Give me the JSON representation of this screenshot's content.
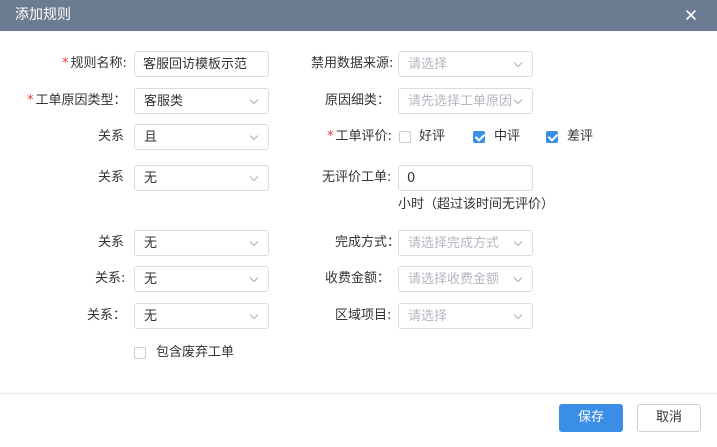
{
  "dialog": {
    "title": "添加规则",
    "close_icon": "close-icon"
  },
  "form": {
    "rule_name": {
      "label": "规则名称:",
      "value": "客服回访模板示范"
    },
    "disable_source": {
      "label": "禁用数据来源:",
      "placeholder": "请选择"
    },
    "order_reason_type": {
      "label": "工单原因类型：",
      "value": "客服类"
    },
    "reason_detail": {
      "label": "原因细类：",
      "placeholder": "请先选择工单原因"
    },
    "relation1": {
      "label": "关系",
      "value": "且"
    },
    "order_rating": {
      "label": "工单评价:",
      "options": [
        {
          "label": "好评",
          "checked": false
        },
        {
          "label": "中评",
          "checked": true
        },
        {
          "label": "差评",
          "checked": true
        }
      ]
    },
    "relation2": {
      "label": "关系",
      "value": "无"
    },
    "no_rating_order": {
      "label": "无评价工单:",
      "value": "0",
      "hint": "小时（超过该时间无评价）"
    },
    "relation3": {
      "label": "关系",
      "value": "无"
    },
    "complete_method": {
      "label": "完成方式：",
      "placeholder": "请选择完成方式"
    },
    "relation4": {
      "label": "关系:",
      "value": "无"
    },
    "fee_amount": {
      "label": "收费金额：",
      "placeholder": "请选择收费金额"
    },
    "relation5": {
      "label": "关系：",
      "value": "无"
    },
    "area_item": {
      "label": "区域项目:",
      "placeholder": "请选择"
    },
    "include_abandoned": {
      "label": "包含废弃工单",
      "checked": false
    }
  },
  "footer": {
    "save_label": "保存",
    "cancel_label": "取消"
  },
  "colors": {
    "header": "#6b7b91",
    "primary": "#3a8ee6",
    "required": "#e4393c"
  }
}
